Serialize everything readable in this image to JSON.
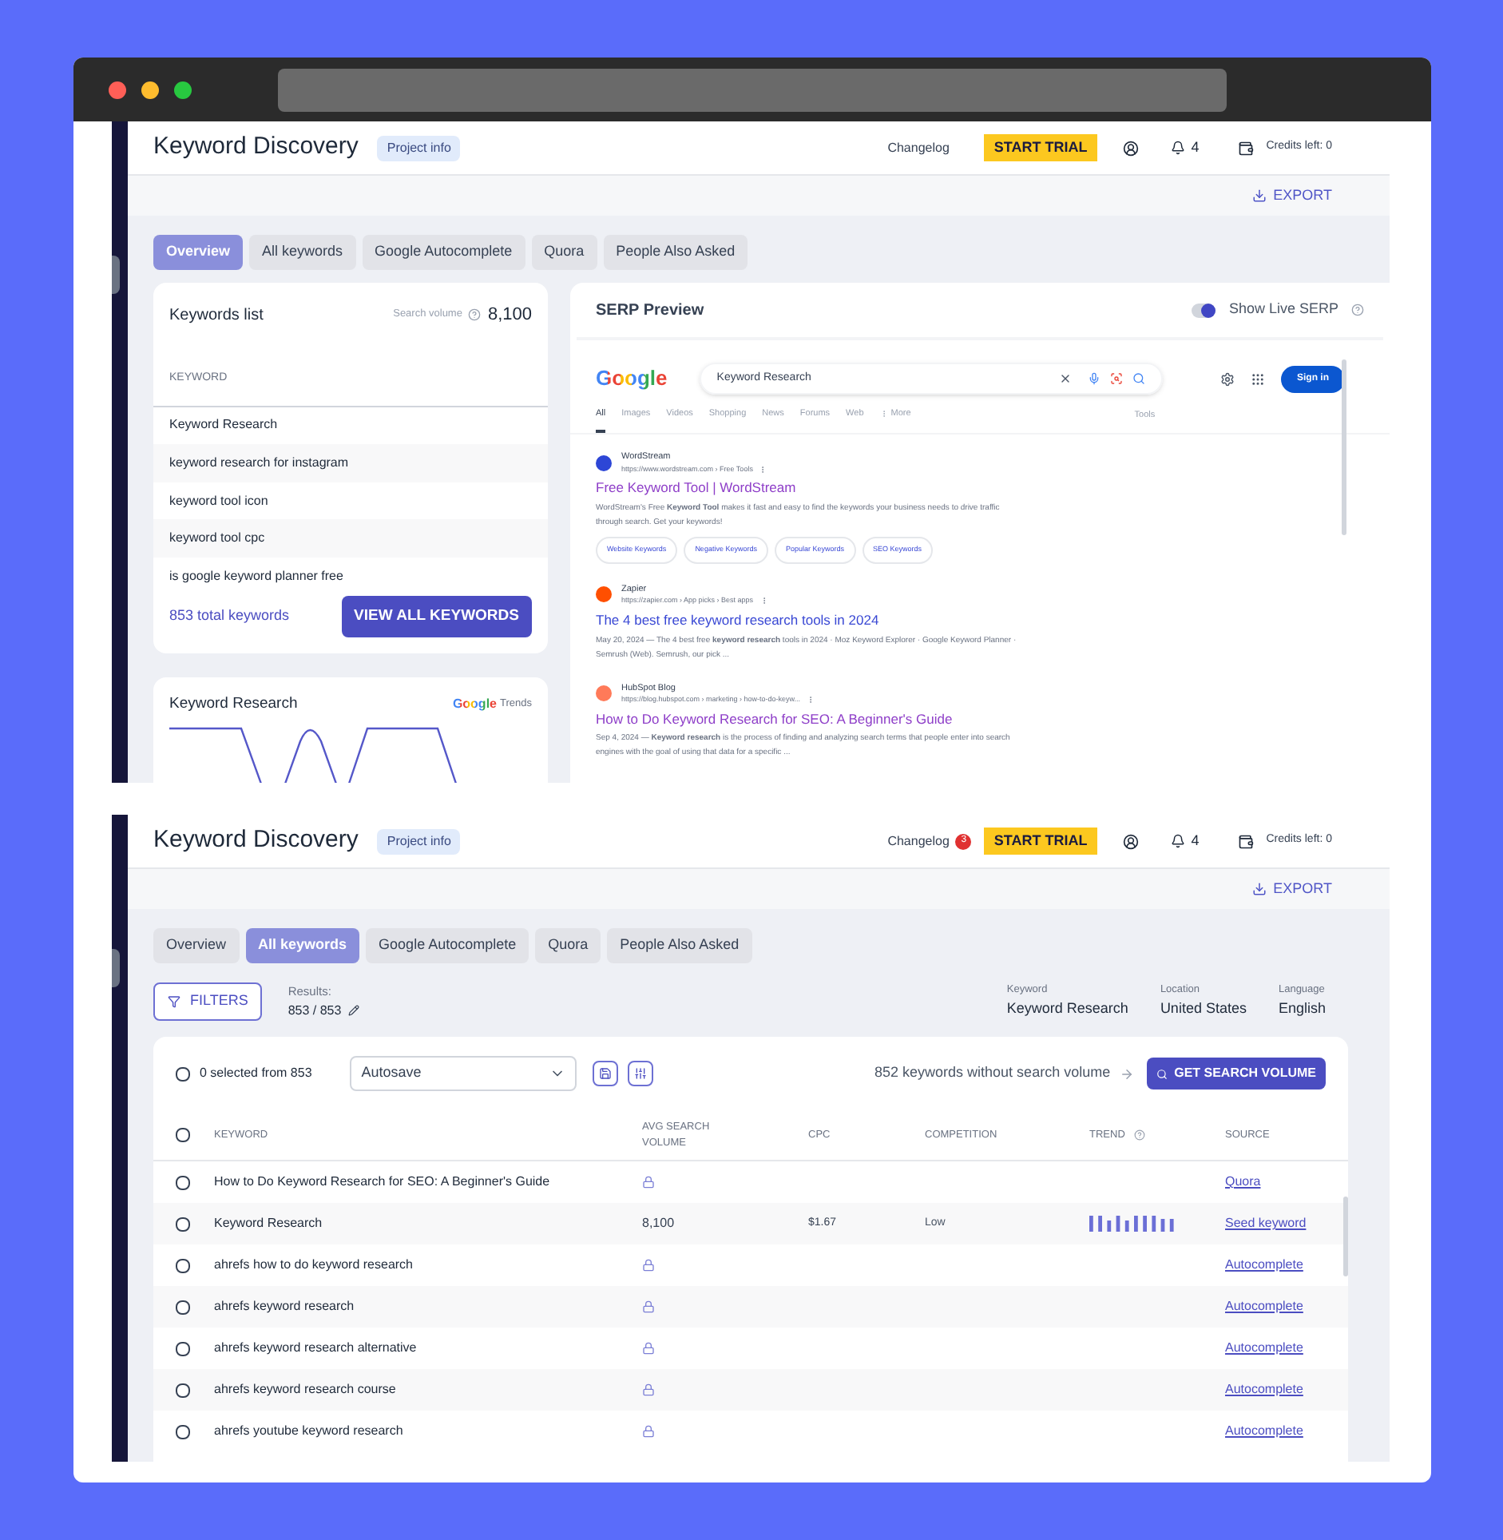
{
  "screens": [
    {
      "kind": "overview",
      "header": {
        "title": "Keyword Discovery",
        "badge": "Project info",
        "changelog": "Changelog",
        "trial": "START TRIAL",
        "notifications": "4",
        "credits": "Credits left: 0"
      },
      "export": "EXPORT",
      "tabs": [
        {
          "label": "Overview",
          "selected": true
        },
        {
          "label": "All keywords",
          "selected": false
        },
        {
          "label": "Google Autocomplete",
          "selected": false
        },
        {
          "label": "Quora",
          "selected": false
        },
        {
          "label": "People Also Asked",
          "selected": false
        }
      ],
      "keywords_card": {
        "title": "Keywords list",
        "volume_label": "Search volume",
        "volume": "8,100",
        "column": "KEYWORD",
        "rows": [
          "Keyword Research",
          "keyword research for instagram",
          "keyword tool icon",
          "keyword tool cpc",
          "is google keyword planner free"
        ],
        "total": "853 total keywords",
        "button": "VIEW ALL KEYWORDS"
      },
      "trends_card": {
        "title": "Keyword Research",
        "brand": "Google",
        "brand_suffix": "Trends"
      },
      "serp": {
        "title": "SERP Preview",
        "toggle": {
          "label": "Show Live SERP",
          "on": true
        },
        "logo": "Google",
        "query": "Keyword Research",
        "sign_in": "Sign in",
        "tools": "Tools",
        "nav": [
          {
            "label": "All",
            "selected": true
          },
          {
            "label": "Images",
            "selected": false
          },
          {
            "label": "Videos",
            "selected": false
          },
          {
            "label": "Shopping",
            "selected": false
          },
          {
            "label": "News",
            "selected": false
          },
          {
            "label": "Forums",
            "selected": false
          },
          {
            "label": "Web",
            "selected": false
          },
          {
            "label": "More",
            "selected": false
          }
        ],
        "results": [
          {
            "site": "WordStream",
            "url": "https://www.wordstream.com › Free Tools",
            "title": "Free Keyword Tool | WordStream",
            "visited": true,
            "color": "#2d46d6",
            "snippet": "WordStream's Free **Keyword Tool** makes it fast and easy to find the keywords your business needs to drive traffic through search. Get your keywords!",
            "chips": [
              "Website Keywords",
              "Negative Keywords",
              "Popular Keywords",
              "SEO Keywords"
            ]
          },
          {
            "site": "Zapier",
            "url": "https://zapier.com › App picks › Best apps",
            "title": "The 4 best free keyword research tools in 2024",
            "visited": false,
            "color": "#ff4f00",
            "snippet": "May 20, 2024 — The 4 best free **keyword research** tools in 2024 · Moz Keyword Explorer · Google Keyword Planner · Semrush (Web). Semrush, our pick ..."
          },
          {
            "site": "HubSpot Blog",
            "url": "https://blog.hubspot.com › marketing › how-to-do-keyw...",
            "title": "How to Do Keyword Research for SEO: A Beginner's Guide",
            "visited": true,
            "color": "#ff7a59",
            "snippet": "Sep 4, 2024 — **Keyword research** is the process of finding and analyzing search terms that people enter into search engines with the goal of using that data for a specific ..."
          }
        ]
      }
    },
    {
      "kind": "all_keywords",
      "header": {
        "title": "Keyword Discovery",
        "badge": "Project info",
        "changelog": "Changelog",
        "changelog_count": "3",
        "trial": "START TRIAL",
        "notifications": "4",
        "credits": "Credits left: 0"
      },
      "export": "EXPORT",
      "tabs": [
        {
          "label": "Overview",
          "selected": false
        },
        {
          "label": "All keywords",
          "selected": true
        },
        {
          "label": "Google Autocomplete",
          "selected": false
        },
        {
          "label": "Quora",
          "selected": false
        },
        {
          "label": "People Also Asked",
          "selected": false
        }
      ],
      "filters": "FILTERS",
      "results_label": "Results:",
      "results": "853 / 853",
      "meta": [
        {
          "label": "Keyword",
          "value": "Keyword Research"
        },
        {
          "label": "Location",
          "value": "United States"
        },
        {
          "label": "Language",
          "value": "English"
        }
      ],
      "toolbar": {
        "selected": "0 selected from 853",
        "select_all_checked": false,
        "preset": "Autosave",
        "no_volume": "852 keywords without search volume",
        "button": "GET SEARCH VOLUME"
      },
      "header_checked": false,
      "columns": [
        "KEYWORD",
        "AVG SEARCH VOLUME",
        "CPC",
        "COMPETITION",
        "TREND",
        "SOURCE"
      ],
      "rows": [
        {
          "keyword": "How to Do Keyword Research for SEO: A Beginner's Guide",
          "locked": true,
          "trend": false,
          "source": "Quora",
          "checked": false
        },
        {
          "keyword": "Keyword Research",
          "locked": false,
          "volume": "8,100",
          "cpc": "$1.67",
          "competition": "Low",
          "trend": true,
          "source": "Seed keyword",
          "checked": false
        },
        {
          "keyword": "ahrefs how to do keyword research",
          "locked": true,
          "trend": false,
          "source": "Autocomplete",
          "checked": false
        },
        {
          "keyword": "ahrefs keyword research",
          "locked": true,
          "trend": false,
          "source": "Autocomplete",
          "checked": false
        },
        {
          "keyword": "ahrefs keyword research alternative",
          "locked": true,
          "trend": false,
          "source": "Autocomplete",
          "checked": false
        },
        {
          "keyword": "ahrefs keyword research course",
          "locked": true,
          "trend": false,
          "source": "Autocomplete",
          "checked": false
        },
        {
          "keyword": "ahrefs youtube keyword research",
          "locked": true,
          "trend": false,
          "source": "Autocomplete",
          "checked": false
        }
      ]
    }
  ]
}
